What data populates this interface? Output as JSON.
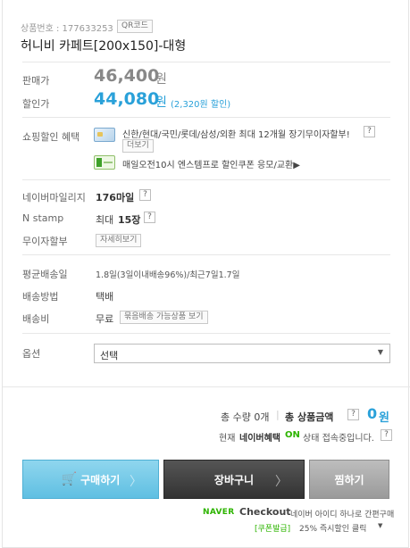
{
  "product": {
    "number_label": "상품번호 : 177633253",
    "qr_label": "QR코드",
    "name": "허니비 카페트[200x150]-대형"
  },
  "price": {
    "sale_label": "판매가",
    "sale_value": "46,400",
    "sale_unit": "원",
    "discount_label": "할인가",
    "discount_value": "44,080",
    "discount_unit": "원",
    "discount_note": "(2,320원 할인)"
  },
  "benefits": {
    "label": "쇼핑할인 혜택",
    "card_text": "신한/현대/국민/롯데/삼성/외환 최대 12개월 장기무이자할부!",
    "card_more": "더보기",
    "coupon_text": "매일오전10시 엔스템프로 할인쿠폰 응모/교환▶"
  },
  "mileage": {
    "label": "네이버마일리지",
    "value": "176마일"
  },
  "nstamp": {
    "label": "N stamp",
    "prefix": "최대",
    "value": "15장"
  },
  "installment": {
    "label": "무이자할부",
    "button": "자세히보기"
  },
  "delivery": {
    "avg_label": "평균배송일",
    "avg_value": "1.8일(3일이내배송96%)/최근7일1.7일",
    "method_label": "배송방법",
    "method_value": "택배",
    "fee_label": "배송비",
    "fee_value": "무료",
    "fee_button": "묶음배송 가능상품 보기"
  },
  "option": {
    "label": "옵션",
    "selected": "선택"
  },
  "totals": {
    "qty_text": "총 수량 0개",
    "amount_label": "총 상품금액",
    "amount_value": "0",
    "amount_unit": "원",
    "naver_prefix": "현재",
    "naver_name": "네이버혜택",
    "naver_on": "ON",
    "naver_suffix": "상태 접속중입니다."
  },
  "buttons": {
    "buy": "구매하기",
    "cart": "장바구니",
    "wish": "찜하기"
  },
  "checkout": {
    "naver": "NAVER",
    "checkout": "Checkout",
    "desc": "네이버 아이디 하나로 간편구매",
    "coupon": "[쿠폰발급]",
    "coupon_desc": "25% 즉시할인 클릭"
  },
  "colors": {
    "accent_blue": "#2aa1d9",
    "naver_green": "#2db400",
    "price_gray": "#888888"
  },
  "icons": [
    "card-icon",
    "coupon-icon",
    "cart-icon",
    "chevron-right-icon",
    "dropdown-arrow-icon"
  ]
}
